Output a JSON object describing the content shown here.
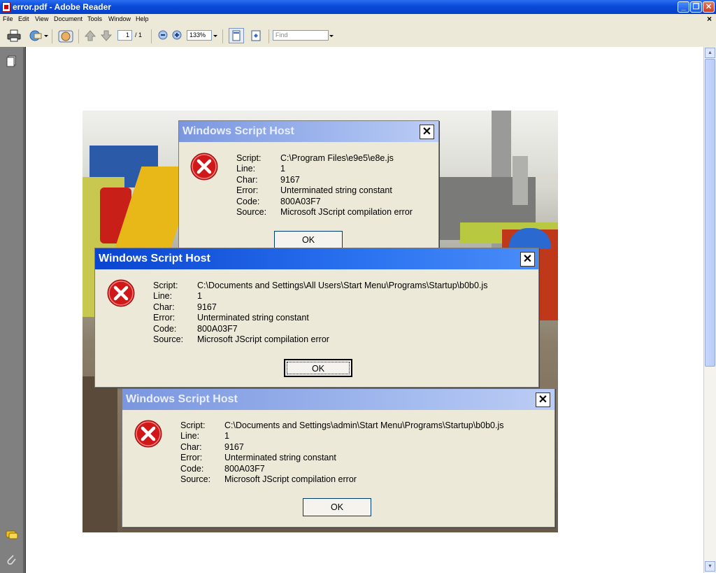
{
  "window": {
    "title": "error.pdf - Adobe Reader",
    "minimize_glyph": "_",
    "maximize_glyph": "❐",
    "close_glyph": "✕"
  },
  "menu": {
    "items": [
      "File",
      "Edit",
      "View",
      "Document",
      "Tools",
      "Window",
      "Help"
    ],
    "close_glyph": "×"
  },
  "toolbar": {
    "page_current": "1",
    "page_total": "/ 1",
    "zoom": "133%",
    "find_placeholder": "Find"
  },
  "dialogs": [
    {
      "title": "Windows Script Host",
      "state": "inactive",
      "close_glyph": "✕",
      "labels": [
        "Script:",
        "Line:",
        "Char:",
        "Error:",
        "Code:",
        "Source:"
      ],
      "values": [
        "C:\\Program Files\\e9e5\\e8e.js",
        "1",
        "9167",
        "Unterminated string constant",
        "800A03F7",
        "Microsoft JScript compilation error"
      ],
      "ok_label": "OK"
    },
    {
      "title": "Windows Script Host",
      "state": "active",
      "close_glyph": "✕",
      "labels": [
        "Script:",
        "Line:",
        "Char:",
        "Error:",
        "Code:",
        "Source:"
      ],
      "values": [
        "C:\\Documents and Settings\\All Users\\Start Menu\\Programs\\Startup\\b0b0.js",
        "1",
        "9167",
        "Unterminated string constant",
        "800A03F7",
        "Microsoft JScript compilation error"
      ],
      "ok_label": "OK"
    },
    {
      "title": "Windows Script Host",
      "state": "inactive",
      "close_glyph": "✕",
      "labels": [
        "Script:",
        "Line:",
        "Char:",
        "Error:",
        "Code:",
        "Source:"
      ],
      "values": [
        "C:\\Documents and Settings\\admin\\Start Menu\\Programs\\Startup\\b0b0.js",
        "1",
        "9167",
        "Unterminated string constant",
        "800A03F7",
        "Microsoft JScript compilation error"
      ],
      "ok_label": "OK"
    }
  ],
  "icons": {
    "app": "adobe-reader-icon",
    "error": "error-x-icon",
    "print": "printer-icon",
    "email": "email-icon",
    "hand": "hand-tool-icon",
    "nav_pages": "pages-icon",
    "nav_comments": "comments-icon",
    "nav_attachments": "paperclip-icon"
  },
  "colors": {
    "titlebar": "#0a4ad8",
    "dialog_bg": "#ece9d8",
    "error_red": "#d01818"
  }
}
